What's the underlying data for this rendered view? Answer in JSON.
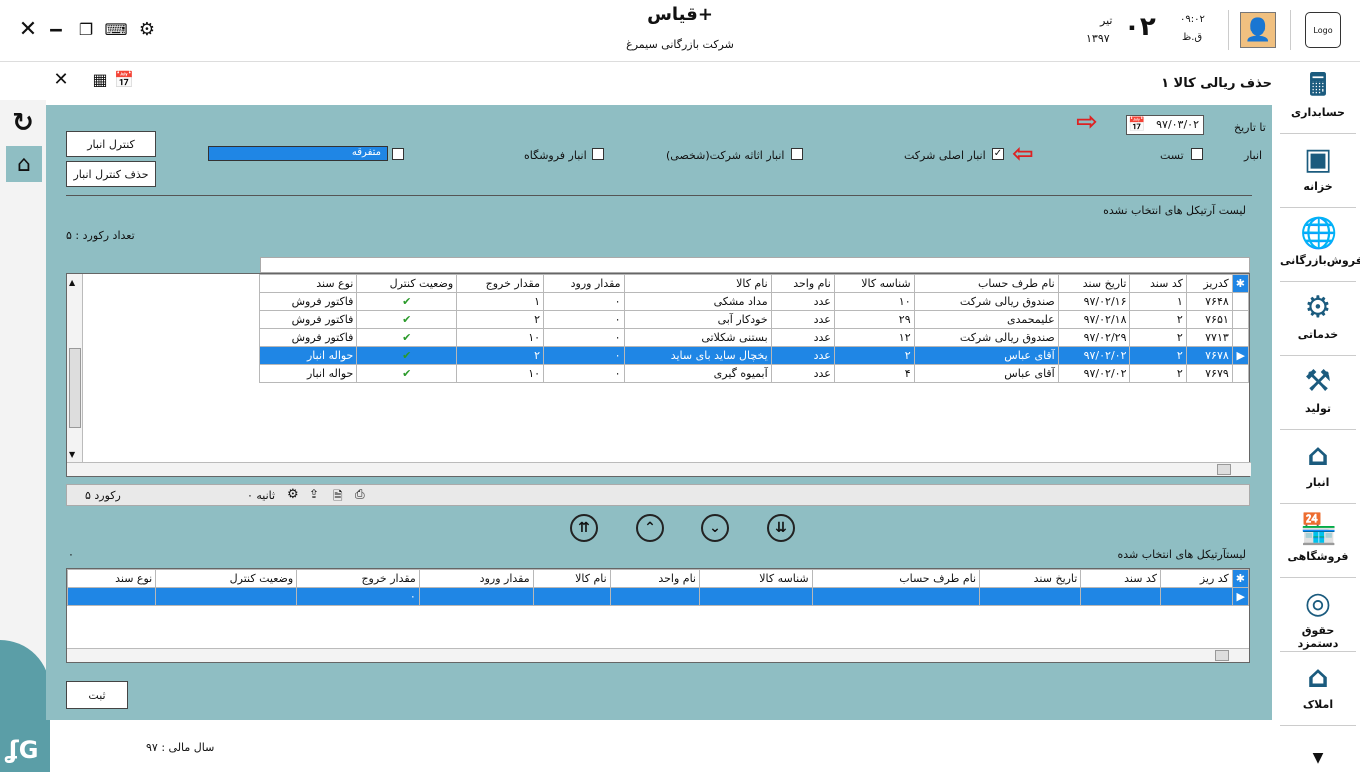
{
  "window": {
    "app_name": "قیاس+",
    "company": "شرکت بازرگانی سیمرغ",
    "time": "۰۹:۰۲",
    "ampm": "ق.ظ",
    "day": "۰۲",
    "month": "تیر",
    "year": "۱۳۹۷",
    "logo_text": "Logo"
  },
  "page": {
    "title": "حذف ريالی کالا ۱"
  },
  "filters": {
    "to_date_label": "تا تاریخ",
    "to_date_value": "۹۷/۰۳/۰۲",
    "warehouse_label": "انبار",
    "checks": [
      {
        "label": "تست",
        "checked": false
      },
      {
        "label": "انبار اصلی شرکت",
        "checked": true
      },
      {
        "label": "انبار اثاثه شرکت(شخصی)",
        "checked": false
      },
      {
        "label": "انبار فروشگاه",
        "checked": false
      },
      {
        "label": "متفرقه",
        "checked": false
      }
    ],
    "btn_control": "کنترل انبار",
    "btn_delete_control": "حذف کنترل انبار"
  },
  "unselected": {
    "title": "لیست آرتیکل های انتخاب نشده",
    "record_count_label": "تعداد رکورد : ۵",
    "columns": [
      "کدریز",
      "کد سند",
      "تاریخ سند",
      "نام طرف حساب",
      "شناسه کالا",
      "نام واحد",
      "نام کالا",
      "مقدار ورود",
      "مقدار خروج",
      "وضعیت کنترل",
      "نوع سند"
    ],
    "rows": [
      [
        "۷۶۴۸",
        "۱",
        "۹۷/۰۲/۱۶",
        "صندوق ریالی شرکت",
        "۱۰",
        "عدد",
        "مداد مشکی",
        "۰",
        "۱",
        "✔",
        "فاکتور فروش"
      ],
      [
        "۷۶۵۱",
        "۲",
        "۹۷/۰۲/۱۸",
        "علیمحمدی",
        "۲۹",
        "عدد",
        "خودکار آبی",
        "۰",
        "۲",
        "✔",
        "فاکتور فروش"
      ],
      [
        "۷۷۱۳",
        "۲",
        "۹۷/۰۲/۲۹",
        "صندوق ریالی شرکت",
        "۱۲",
        "عدد",
        "بستنی شکلاتی",
        "۰",
        "۱۰",
        "✔",
        "فاکتور فروش"
      ],
      [
        "۷۶۷۸",
        "۲",
        "۹۷/۰۲/۰۲",
        "آقای عباس",
        "۲",
        "عدد",
        "یخچال ساید بای ساید",
        "۰",
        "۲",
        "✔",
        "حواله انبار"
      ],
      [
        "۷۶۷۹",
        "۲",
        "۹۷/۰۲/۰۲",
        "آقای عباس",
        "۴",
        "عدد",
        "آبمیوه گیری",
        "۰",
        "۱۰",
        "✔",
        "حواله انبار"
      ]
    ],
    "selected_row": 3,
    "status_records": "۵ رکورد",
    "status_seconds": "۰ ثانیه"
  },
  "selected": {
    "title": "لیستآرتیکل های انتخاب شده",
    "count": "۰",
    "columns": [
      "کد ریز",
      "کد سند",
      "تاریخ سند",
      "نام طرف حساب",
      "شناسه کالا",
      "نام واحد",
      "نام کالا",
      "مقدار ورود",
      "مقدار خروج",
      "وضعیت کنترل",
      "نوع سند"
    ],
    "row": [
      "",
      "",
      "",
      "",
      "",
      "",
      "",
      "",
      "۰",
      "",
      ""
    ]
  },
  "submit_label": "ثبت",
  "fiscal_year": "سال مالی : ۹۷",
  "nav": [
    {
      "label": "حسابداری",
      "icon": "accounting-icon"
    },
    {
      "label": "خزانه",
      "icon": "safe-icon"
    },
    {
      "label": "فروش‌بازرگانی",
      "icon": "globe-icon"
    },
    {
      "label": "خدماتی",
      "icon": "gear-icon"
    },
    {
      "label": "تولید",
      "icon": "worker-icon"
    },
    {
      "label": "انبار",
      "icon": "warehouse-icon"
    },
    {
      "label": "فروشگاهی",
      "icon": "shop-icon"
    },
    {
      "label": "حقوق دستمزد",
      "icon": "coins-icon"
    },
    {
      "label": "املاک",
      "icon": "house-icon"
    }
  ],
  "colors": {
    "panel": "#8fbec3",
    "selected": "#1f86e5",
    "nav_icon": "#1b5b7e",
    "arrow": "#dd2222"
  }
}
